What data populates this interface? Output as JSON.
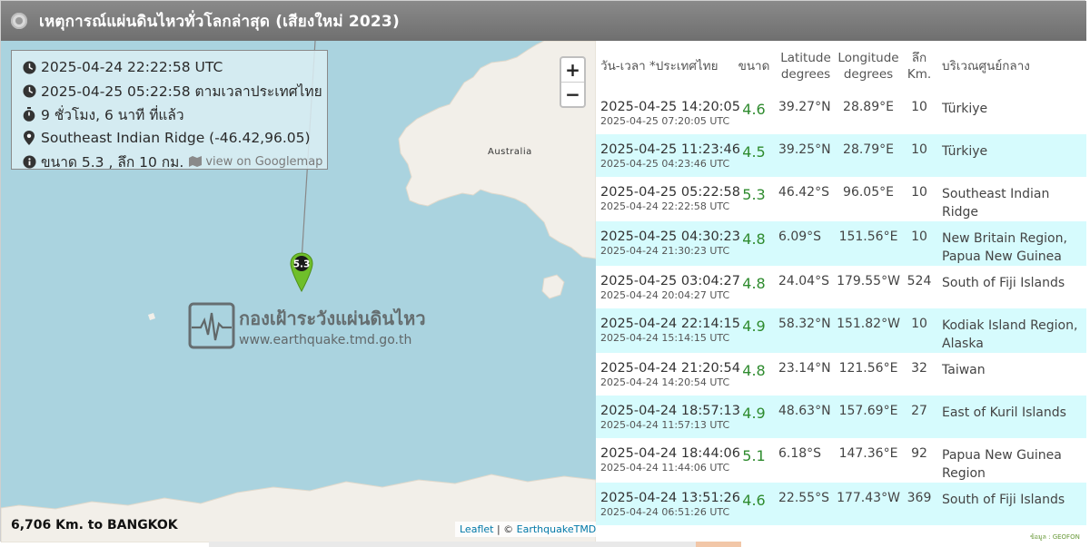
{
  "header": {
    "title": "เหตุการณ์แผ่นดินไหวทั่วโลกล่าสุด (เสียงใหม่ 2023)"
  },
  "info": {
    "utc_time": "2025-04-24 22:22:58 UTC",
    "thai_time": "2025-04-25 05:22:58 ตามเวลาประเทศไทย",
    "elapsed": "9 ชั่วโมง, 6 นาที ที่แล้ว",
    "location": "Southeast Indian Ridge (-46.42,96.05)",
    "magnitude_depth": "ขนาด 5.3 , ลึก 10 กม.",
    "gmap_link": "view on Googlemap"
  },
  "map": {
    "zoom_in": "+",
    "zoom_out": "−",
    "place_label": "Australia",
    "marker_label": "5.3",
    "watermark_title": "กองเฝ้าระวังแผ่นดินไหว",
    "watermark_url": "www.earthquake.tmd.go.th",
    "distance": "6,706 Km. to BANGKOK",
    "attribution_leaflet": "Leaflet",
    "attribution_sep": " | © ",
    "attribution_owner": "EarthquakeTMD",
    "colors": {
      "ocean": "#aad3df",
      "land": "#f2efe9",
      "marker": "#6fbf2a"
    }
  },
  "table": {
    "headers": {
      "date": "วัน-เวลา *ประเทศไทย",
      "mag": "ขนาด",
      "lat": "Latitude",
      "lat_unit": "degrees",
      "lon": "Longitude",
      "lon_unit": "degrees",
      "depth": "ลึก",
      "depth_unit": "Km.",
      "region": "บริเวณศูนย์กลาง"
    },
    "rows": [
      {
        "local": "2025-04-25 14:20:05",
        "utc": "2025-04-25 07:20:05 UTC",
        "mag": "4.6",
        "lat": "39.27°N",
        "lon": "28.89°E",
        "depth": "10",
        "region": "Türkiye"
      },
      {
        "local": "2025-04-25 11:23:46",
        "utc": "2025-04-25 04:23:46 UTC",
        "mag": "4.5",
        "lat": "39.25°N",
        "lon": "28.79°E",
        "depth": "10",
        "region": "Türkiye"
      },
      {
        "local": "2025-04-25 05:22:58",
        "utc": "2025-04-24 22:22:58 UTC",
        "mag": "5.3",
        "lat": "46.42°S",
        "lon": "96.05°E",
        "depth": "10",
        "region": "Southeast Indian Ridge"
      },
      {
        "local": "2025-04-25 04:30:23",
        "utc": "2025-04-24 21:30:23 UTC",
        "mag": "4.8",
        "lat": "6.09°S",
        "lon": "151.56°E",
        "depth": "10",
        "region": "New Britain Region, Papua New Guinea"
      },
      {
        "local": "2025-04-25 03:04:27",
        "utc": "2025-04-24 20:04:27 UTC",
        "mag": "4.8",
        "lat": "24.04°S",
        "lon": "179.55°W",
        "depth": "524",
        "region": "South of Fiji Islands"
      },
      {
        "local": "2025-04-24 22:14:15",
        "utc": "2025-04-24 15:14:15 UTC",
        "mag": "4.9",
        "lat": "58.32°N",
        "lon": "151.82°W",
        "depth": "10",
        "region": "Kodiak Island Region, Alaska"
      },
      {
        "local": "2025-04-24 21:20:54",
        "utc": "2025-04-24 14:20:54 UTC",
        "mag": "4.8",
        "lat": "23.14°N",
        "lon": "121.56°E",
        "depth": "32",
        "region": "Taiwan"
      },
      {
        "local": "2025-04-24 18:57:13",
        "utc": "2025-04-24 11:57:13 UTC",
        "mag": "4.9",
        "lat": "48.63°N",
        "lon": "157.69°E",
        "depth": "27",
        "region": "East of Kuril Islands"
      },
      {
        "local": "2025-04-24 18:44:06",
        "utc": "2025-04-24 11:44:06 UTC",
        "mag": "5.1",
        "lat": "6.18°S",
        "lon": "147.36°E",
        "depth": "92",
        "region": "Papua New Guinea Region"
      },
      {
        "local": "2025-04-24 13:51:26",
        "utc": "2025-04-24 06:51:26 UTC",
        "mag": "4.6",
        "lat": "22.55°S",
        "lon": "177.43°W",
        "depth": "369",
        "region": "South of Fiji Islands"
      }
    ],
    "mag_color": "#2e8b2e",
    "row_alt_color": "#d6fbfd"
  },
  "footer": {
    "source": "ข้อมูล : GEOFON"
  }
}
